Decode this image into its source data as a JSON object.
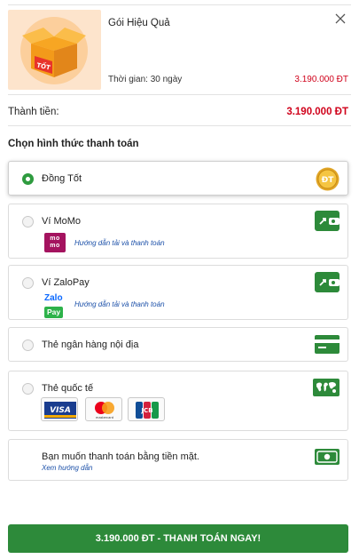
{
  "package": {
    "name": "Gói Hiệu Quả",
    "duration": "Thời gian: 30 ngày",
    "price": "3.190.000 ĐT",
    "thumb_text": "TỐT"
  },
  "total": {
    "label": "Thành tiền:",
    "value": "3.190.000 ĐT"
  },
  "payment": {
    "title": "Chọn hình thức thanh toán",
    "options": [
      {
        "label": "Đồng Tốt",
        "icon": "dong-tot-coin-icon",
        "selected": true,
        "badge": "ĐT"
      },
      {
        "label": "Ví MoMo",
        "icon": "wallet-icon",
        "brand": "mo mo",
        "guide": "Hướng dẫn tải và thanh toán"
      },
      {
        "label": "Ví ZaloPay",
        "icon": "wallet-icon",
        "brand_top": "Zalo",
        "brand_bottom": "Pay",
        "guide": "Hướng dẫn tải và thanh toán"
      },
      {
        "label": "Thẻ ngân hàng nội địa",
        "icon": "bank-card-icon"
      },
      {
        "label": "Thẻ quốc tế",
        "icon": "world-map-icon",
        "cards": [
          "VISA",
          "mastercard",
          "JCB"
        ]
      },
      {
        "label": "Bạn muốn thanh toán bằng tiền mặt.",
        "icon": "cash-icon",
        "guide": "Xem hướng dẫn"
      }
    ]
  },
  "cta": {
    "label": "3.190.000 ĐT - THANH TOÁN NGAY!"
  },
  "colors": {
    "accent_green": "#2d8a3a",
    "price_red": "#d0021b",
    "link_blue": "#1a4fa8"
  }
}
